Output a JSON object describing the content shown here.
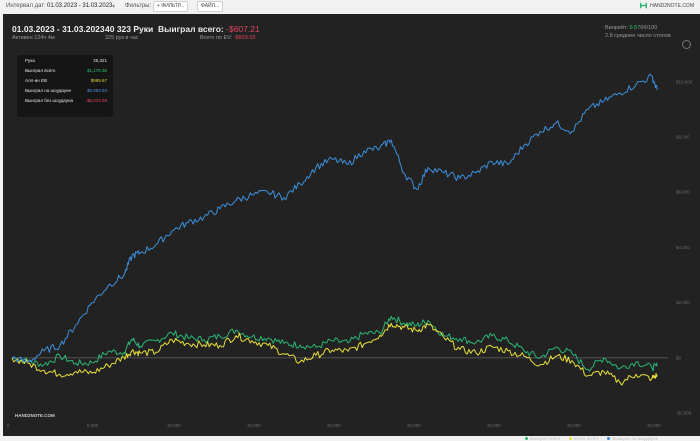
{
  "toolbar": {
    "interval_label": "Интервал дат:",
    "interval_value": "01.03.2023 - 31.03.2023",
    "filters_label": "Фильтры:",
    "filter_button": "+ ФИЛЬТР...",
    "files_button": "ФАЙЛ...",
    "logo_text": "HAND2NOTE.COM"
  },
  "header": {
    "date_range": "01.03.2023 - 31.03.2023",
    "active": "Активен 124ч 4м",
    "hands": "40 323 Руки",
    "hands_rate": "325 рук в час",
    "won_label": "Выиграл всего:",
    "won_value": "-$607.21",
    "ev_label": "Всего по EV:",
    "ev_value": "-$829.03",
    "winrate_label": "Винрейт:",
    "winrate_value": "0.57",
    "winrate_unit": "бб/100",
    "tables": "2.8 среднее число столов"
  },
  "tooltip": {
    "rows": [
      {
        "label": "Рука",
        "value": "25,321",
        "color": "#e6e6e6"
      },
      {
        "label": "Выиграл всего",
        "value": "$1,170.36",
        "color": "#3cc26f"
      },
      {
        "label": "Алл-ин ЕВ",
        "value": "$989.67",
        "color": "#e2d33b"
      },
      {
        "label": "Выиграл на шоудауне",
        "value": "$6,093.94",
        "color": "#4a90e2"
      },
      {
        "label": "Выиграл без шоудауна",
        "value": "-$5,022.58",
        "color": "#e0455a"
      }
    ]
  },
  "chart_data": {
    "type": "line",
    "ylim": [
      -2000,
      10500
    ],
    "xlim": [
      0,
      41000
    ],
    "yticks": [
      "$10,000",
      "$8,000",
      "$6,000",
      "$4,000",
      "$2,000",
      "$0",
      "-$2,000"
    ],
    "ytick_values": [
      10000,
      8000,
      6000,
      4000,
      2000,
      0,
      -2000
    ],
    "xticks": [
      "0",
      "5,000",
      "10,000",
      "15,000",
      "20,000",
      "25,000",
      "30,000",
      "35,000",
      "40,000"
    ],
    "xtick_values": [
      0,
      5000,
      10000,
      15000,
      20000,
      25000,
      30000,
      35000,
      40000
    ],
    "x": [
      0,
      1000,
      2000,
      3000,
      4000,
      5000,
      6000,
      7000,
      7500,
      8000,
      9000,
      10000,
      11000,
      12000,
      13000,
      14000,
      15000,
      16000,
      17000,
      18000,
      19000,
      20000,
      21000,
      22000,
      23000,
      23700,
      24500,
      25300,
      26000,
      27000,
      28000,
      29000,
      30000,
      31000,
      32000,
      33000,
      34000,
      35000,
      36000,
      37000,
      38000,
      39000,
      40000,
      40323
    ],
    "series": [
      {
        "name": "Выиграл всего",
        "color": "#2bb673",
        "values": [
          0,
          -120,
          -250,
          60,
          -200,
          -180,
          230,
          200,
          680,
          420,
          620,
          900,
          720,
          660,
          780,
          1000,
          760,
          720,
          520,
          460,
          380,
          620,
          540,
          880,
          900,
          1500,
          1250,
          1170,
          1350,
          800,
          700,
          550,
          800,
          620,
          260,
          0,
          380,
          160,
          -420,
          0,
          -380,
          -150,
          -360,
          -300
        ]
      },
      {
        "name": "Всего по EV",
        "color": "#e8df3a",
        "values": [
          0,
          -200,
          -450,
          -600,
          -500,
          -550,
          -280,
          20,
          250,
          180,
          200,
          650,
          520,
          470,
          450,
          800,
          620,
          450,
          150,
          -150,
          90,
          280,
          240,
          500,
          820,
          1250,
          1100,
          990,
          1200,
          720,
          300,
          180,
          400,
          250,
          60,
          -250,
          60,
          -100,
          -650,
          -500,
          -900,
          -600,
          -750,
          -620
        ]
      },
      {
        "name": "Выиграл на шоудауне",
        "color": "#3d8fdb",
        "values": [
          0,
          -150,
          250,
          450,
          1200,
          2000,
          2600,
          3000,
          3700,
          3800,
          4100,
          4600,
          4900,
          5100,
          5400,
          5700,
          5900,
          6000,
          5800,
          6300,
          6900,
          7200,
          7000,
          7500,
          7600,
          7900,
          6700,
          6100,
          6900,
          6700,
          6500,
          6700,
          7100,
          7000,
          7700,
          8200,
          8500,
          8200,
          9000,
          9300,
          9600,
          9900,
          10200,
          9700
        ]
      }
    ]
  },
  "legend": [
    {
      "label": "Выиграл всего",
      "color": "#2bb673"
    },
    {
      "label": "Всего по EV",
      "color": "#e8df3a"
    },
    {
      "label": "Выиграл на шоудауне",
      "color": "#3d8fdb"
    }
  ],
  "watermark": "HAND2NOTE.COM"
}
